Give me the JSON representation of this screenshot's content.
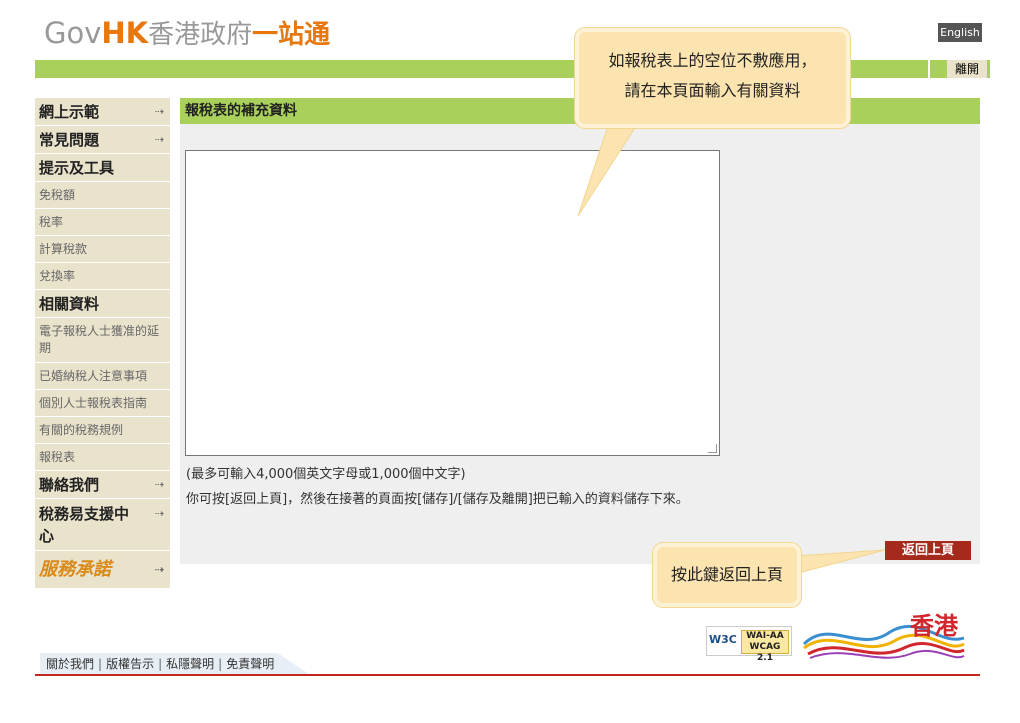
{
  "header": {
    "logo_gov": "Gov",
    "logo_hk": "HK",
    "logo_zh": "香港政府",
    "logo_zh2": "一站通",
    "english_label": "English",
    "exit_label": "離開"
  },
  "sidebar": {
    "items": [
      {
        "label": "網上示範",
        "arrow": "⇢"
      },
      {
        "label": "常見問題",
        "arrow": "⇢"
      },
      {
        "label": "提示及工具"
      },
      {
        "label": "免稅額"
      },
      {
        "label": "稅率"
      },
      {
        "label": "計算稅款"
      },
      {
        "label": "兌換率"
      },
      {
        "label": "相關資料"
      },
      {
        "label": "電子報稅人士獲准的延期"
      },
      {
        "label": "已婚納稅人注意事項"
      },
      {
        "label": "個別人士報稅表指南"
      },
      {
        "label": "有關的稅務規例"
      },
      {
        "label": "報稅表"
      },
      {
        "label": "聯絡我們",
        "arrow": "⇢"
      },
      {
        "label": "稅務易支援中心",
        "arrow": "⇢"
      },
      {
        "label": "服務承諾",
        "arrow": "⇢"
      }
    ]
  },
  "main": {
    "title": "報稅表的補充資料",
    "textarea_value": "",
    "note1": "(最多可輸入4,000個英文字母或1,000個中文字)",
    "note2": "你可按[返回上頁]，然後在接著的頁面按[儲存]/[儲存及離開]把已輸入的資料儲存下來。",
    "back_label": "返回上頁"
  },
  "callouts": {
    "top_line1": "如報稅表上的空位不敷應用，",
    "top_line2": "請在本頁面輸入有關資料",
    "bottom": "按此鍵返回上頁"
  },
  "footer": {
    "links": [
      "關於我們",
      "版權告示",
      "私隱聲明",
      "免責聲明"
    ],
    "separator": "|",
    "w3c": "W3C",
    "wcag_line1": "WAI-AA",
    "wcag_line2": "WCAG 2.1",
    "brand_text": "香港"
  },
  "colors": {
    "accent_green": "#a9d05a",
    "sidebar_bg": "#e9e3cc",
    "back_button": "#a52a1c",
    "footer_line": "#c0281c",
    "callout_bg": "#fbe4b0"
  }
}
